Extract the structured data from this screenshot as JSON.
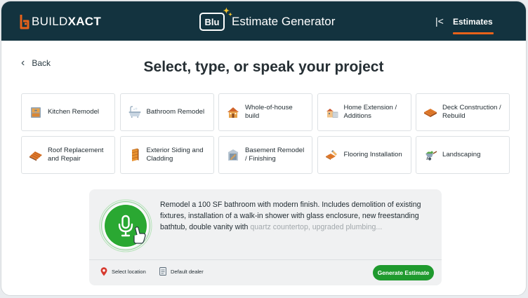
{
  "header": {
    "brand_light": "BUILD",
    "brand_bold": "XACT",
    "badge": "Blu",
    "title": "Estimate Generator",
    "nav_label": "Estimates",
    "collapse_glyph": "|<"
  },
  "back_label": "Back",
  "page_title": "Select, type, or speak your project",
  "tiles": [
    {
      "label": "Kitchen Remodel",
      "icon": "cabinet-icon"
    },
    {
      "label": "Bathroom Remodel",
      "icon": "bathtub-icon"
    },
    {
      "label": "Whole-of-house build",
      "icon": "house-icon"
    },
    {
      "label": "Home Extension / Additions",
      "icon": "extension-icon"
    },
    {
      "label": "Deck Construction / Rebuild",
      "icon": "deck-icon"
    },
    {
      "label": "Roof Replacement and Repair",
      "icon": "roof-icon"
    },
    {
      "label": "Exterior Siding and Cladding",
      "icon": "siding-icon"
    },
    {
      "label": "Basement Remodel / Finishing",
      "icon": "basement-icon"
    },
    {
      "label": "Flooring Installation",
      "icon": "flooring-icon"
    },
    {
      "label": "Landscaping",
      "icon": "wheelbarrow-icon"
    }
  ],
  "prompt": {
    "text": "Remodel a 100 SF bathroom with modern finish. Includes demolition of existing fixtures, installation of a walk-in shower with glass enclosure, new freestanding bathtub, double vanity with ",
    "faded": "quartz countertop, upgraded plumbing..."
  },
  "footer": {
    "location_label": "Select location",
    "dealer_label": "Default dealer",
    "generate_label": "Generate Estimate"
  },
  "colors": {
    "header_bg": "#13333f",
    "accent_orange": "#e8621a",
    "mic_green": "#1f9a2e",
    "location_red": "#d63a2f"
  }
}
